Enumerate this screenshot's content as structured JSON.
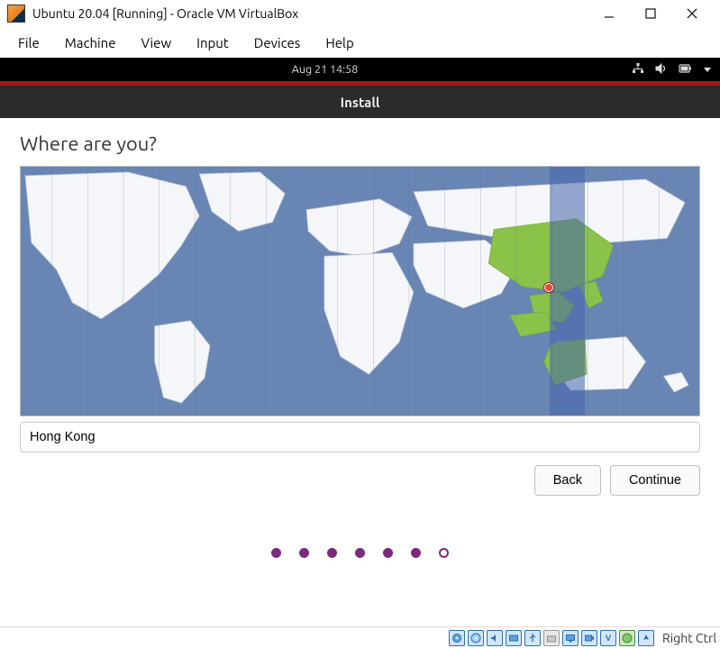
{
  "window": {
    "title": "Ubuntu 20.04 [Running] - Oracle VM VirtualBox",
    "menu": [
      "File",
      "Machine",
      "View",
      "Input",
      "Devices",
      "Help"
    ]
  },
  "ubuntu_topbar": {
    "clock": "Aug 21  14:58"
  },
  "install": {
    "header": "Install",
    "heading": "Where are you?",
    "location_value": "Hong Kong",
    "buttons": {
      "back": "Back",
      "continue": "Continue"
    },
    "progress": {
      "total": 7,
      "current": 6
    }
  },
  "vbox_status": {
    "hostkey": "Right Ctrl"
  }
}
